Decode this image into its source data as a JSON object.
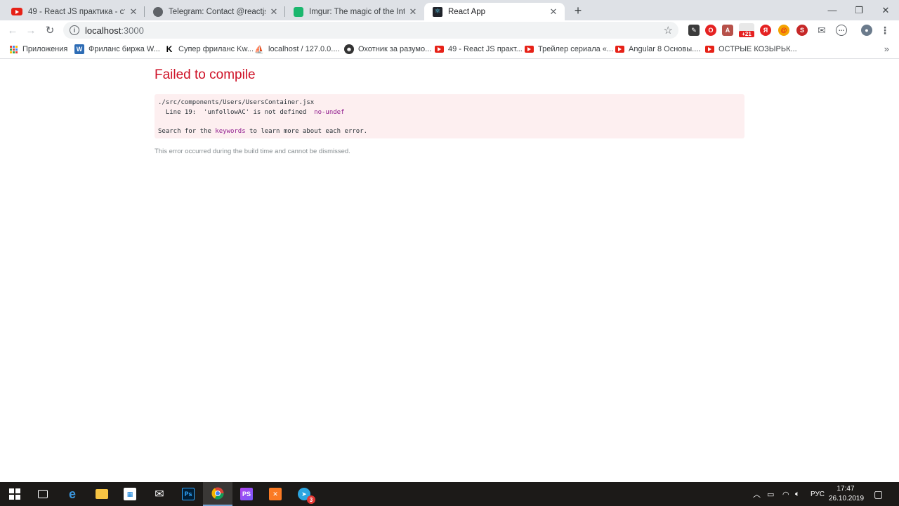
{
  "tabs": [
    {
      "title": "49 - React JS практика - страниц",
      "favicon": "youtube-icon"
    },
    {
      "title": "Telegram: Contact @reactjs_sam",
      "favicon": "globe-icon"
    },
    {
      "title": "Imgur: The magic of the Internet",
      "favicon": "imgur-icon"
    },
    {
      "title": "React App",
      "favicon": "react-icon"
    }
  ],
  "omnibox": {
    "host": "localhost",
    "port": ":3000"
  },
  "bookmarks": [
    {
      "label": "Приложения",
      "icon": "apps-grid-icon"
    },
    {
      "label": "Фриланс биржа W...",
      "icon": "w-icon"
    },
    {
      "label": "Супер фриланс Kw...",
      "icon": "kwork-icon"
    },
    {
      "label": "localhost / 127.0.0....",
      "icon": "phpmyadmin-icon"
    },
    {
      "label": "Охотник за разумо...",
      "icon": "avatar-icon"
    },
    {
      "label": "49 - React JS практ...",
      "icon": "youtube-icon"
    },
    {
      "label": "Трейлер сериала «...",
      "icon": "youtube-icon"
    },
    {
      "label": "Angular 8 Основы....",
      "icon": "youtube-icon"
    },
    {
      "label": "ОСТРЫЕ КОЗЫРЬК...",
      "icon": "youtube-icon"
    }
  ],
  "extensions": {
    "badge_count": "+21"
  },
  "error": {
    "title": "Failed to compile",
    "file": "./src/components/Users/UsersContainer.jsx",
    "line_prefix": "  Line 19:  'unfollowAC' is not defined  ",
    "rule": "no-undef",
    "search_prefix": "Search for the ",
    "keywords": "keywords",
    "search_suffix": " to learn more about each error.",
    "footer": "This error occurred during the build time and cannot be dismissed."
  },
  "taskbar": {
    "telegram_badge": "3",
    "language": "РУС",
    "time": "17:47",
    "date": "26.10.2019"
  },
  "colors": {
    "error_red": "#ce1126",
    "error_bg": "#fdeff0",
    "keyword_purple": "#8f1a8d"
  }
}
